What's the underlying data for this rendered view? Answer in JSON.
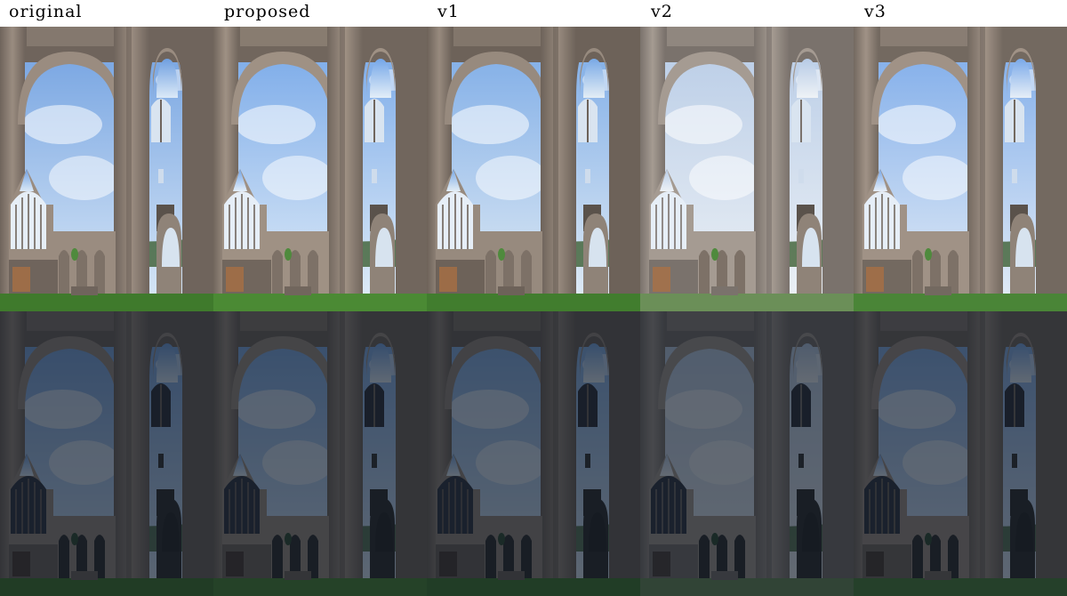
{
  "columns": [
    {
      "label": "original",
      "sky_top": "#6f9fe0",
      "sky_bottom": "#dbe9f7",
      "stone": "#6f645c",
      "stone_light": "#9a8c80",
      "grass": "#3f7a2c"
    },
    {
      "label": "proposed",
      "sky_top": "#74a6e8",
      "sky_bottom": "#e3eef8",
      "stone": "#71665d",
      "stone_light": "#9f9184",
      "grass": "#4b8a34"
    },
    {
      "label": "v1",
      "sky_top": "#79a9e6",
      "sky_bottom": "#e3edf5",
      "stone": "#6d6259",
      "stone_light": "#978a7e",
      "grass": "#417d2e"
    },
    {
      "label": "v2",
      "sky_top": "#b7cbe6",
      "sky_bottom": "#eef2f6",
      "stone": "#7a726c",
      "stone_light": "#a59b92",
      "grass": "#6b8f58"
    },
    {
      "label": "v3",
      "sky_top": "#7aa9e9",
      "sky_bottom": "#e6eef7",
      "stone": "#736960",
      "stone_light": "#a09286",
      "grass": "#4a8537"
    }
  ],
  "rows": [
    {
      "row": "bright"
    },
    {
      "row": "dark"
    }
  ]
}
